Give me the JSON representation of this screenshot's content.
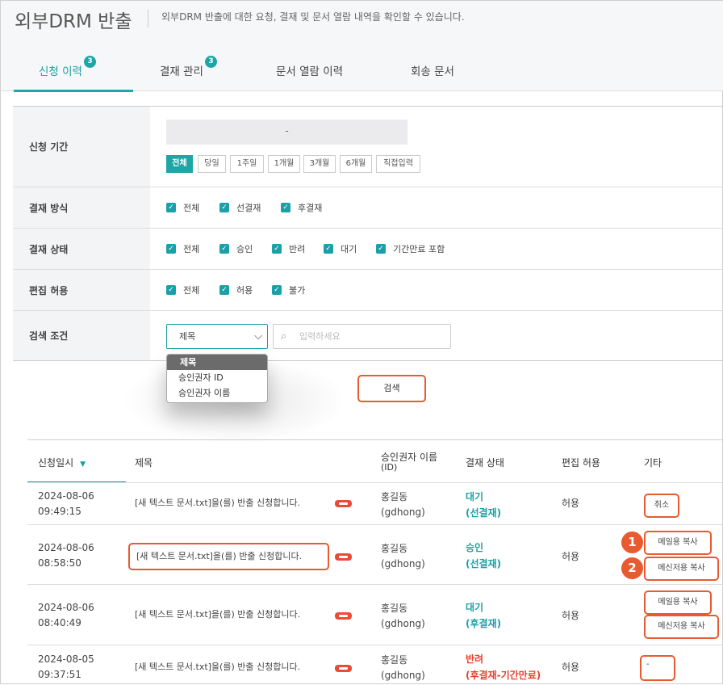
{
  "header": {
    "title": "외부DRM 반출",
    "description": "외부DRM 반출에 대한 요청, 결재 및 문서 열람 내역을 확인할 수 있습니다."
  },
  "tabs": [
    {
      "label": "신청 이력",
      "badge": "3"
    },
    {
      "label": "결재 관리",
      "badge": "3"
    },
    {
      "label": "문서 열람 이력"
    },
    {
      "label": "회송 문서"
    }
  ],
  "filters": {
    "period_label": "신청 기간",
    "date_separator": "-",
    "period_buttons": [
      "전체",
      "당일",
      "1주일",
      "1개월",
      "3개월",
      "6개월",
      "직접입력"
    ],
    "approval_method_label": "결재 방식",
    "approval_method": [
      "전체",
      "선결재",
      "후결재"
    ],
    "approval_status_label": "결재 상태",
    "approval_status": [
      "전체",
      "승인",
      "반려",
      "대기",
      "기간만료 포함"
    ],
    "edit_allow_label": "편집 허용",
    "edit_allow": [
      "전체",
      "허용",
      "불가"
    ],
    "search_label": "검색 조건",
    "search_select": "제목",
    "search_placeholder": "입력하세요",
    "dropdown_options": [
      "제목",
      "승인권자 ID",
      "승인권자 이름"
    ],
    "search_button": "검색"
  },
  "table": {
    "headers": {
      "date": "신청일시",
      "title": "제목",
      "approver": "승인권자 이름",
      "approver_sub": "(ID)",
      "status": "결재 상태",
      "edit": "편집 허용",
      "etc": "기타"
    },
    "rows": [
      {
        "date": "2024-08-06",
        "time": "09:49:15",
        "title": "[새 텍스트 문서.txt]을(를) 반출 신청합니다.",
        "approver": "홍길동",
        "approver_id": "(gdhong)",
        "status": "대기",
        "status_sub": "(선결재)",
        "edit": "허용",
        "etc": [
          "취소"
        ]
      },
      {
        "date": "2024-08-06",
        "time": "08:58:50",
        "title": "[새 텍스트 문서.txt]을(를) 반출 신청합니다.",
        "approver": "홍길동",
        "approver_id": "(gdhong)",
        "status": "승인",
        "status_sub": "(선결재)",
        "edit": "허용",
        "etc": [
          "메일용 복사",
          "메신저용 복사"
        ]
      },
      {
        "date": "2024-08-06",
        "time": "08:40:49",
        "title": "[새 텍스트 문서.txt]을(를) 반출 신청합니다.",
        "approver": "홍길동",
        "approver_id": "(gdhong)",
        "status": "대기",
        "status_sub": "(후결재)",
        "edit": "허용",
        "etc": [
          "메일용 복사",
          "메신저용 복사"
        ]
      },
      {
        "date": "2024-08-05",
        "time": "09:37:51",
        "title": "[새 텍스트 문서.txt]을(를) 반출 신청합니다.",
        "approver": "홍길동",
        "approver_id": "(gdhong)",
        "status": "반려",
        "status_sub": "(후결재-기간만료)",
        "edit": "허용",
        "etc": [
          "-"
        ]
      }
    ]
  },
  "callouts": [
    "1",
    "2"
  ],
  "colors": {
    "accent": "#1ea5a6",
    "highlight": "#e85a2f",
    "rejected": "#e8402a"
  }
}
